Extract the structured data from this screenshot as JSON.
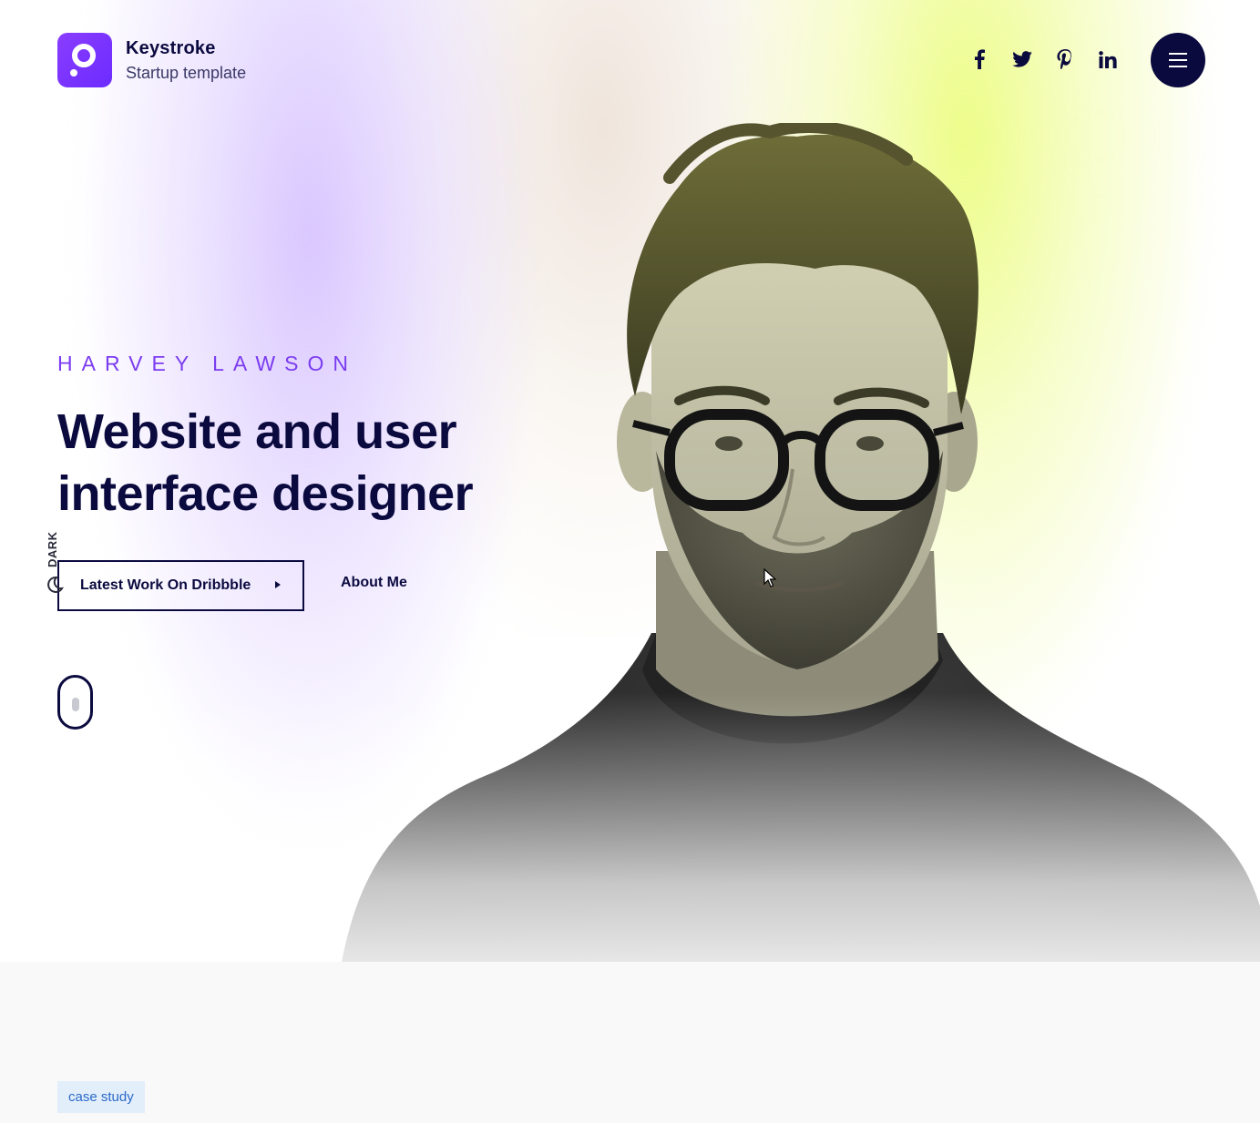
{
  "brand": {
    "name": "Keystroke",
    "subtitle": "Startup template",
    "logo_color": "#7c3aff"
  },
  "header": {
    "socials": [
      {
        "name": "facebook",
        "icon": "facebook-icon"
      },
      {
        "name": "twitter",
        "icon": "twitter-icon"
      },
      {
        "name": "pinterest",
        "icon": "pinterest-icon"
      },
      {
        "name": "linkedin",
        "icon": "linkedin-icon"
      }
    ],
    "menu_icon": "hamburger-menu-icon",
    "menu_color": "#0b0a3f"
  },
  "hero": {
    "eyebrow": "HARVEY LAWSON",
    "headline": "Website and user interface designer",
    "primary_button": "Latest Work On Dribbble",
    "secondary_button": "About Me",
    "theme_toggle_label": "DARK",
    "accent_color": "#7b3cf0",
    "text_color": "#0b0a3f"
  },
  "next_section": {
    "tag": "case study"
  }
}
